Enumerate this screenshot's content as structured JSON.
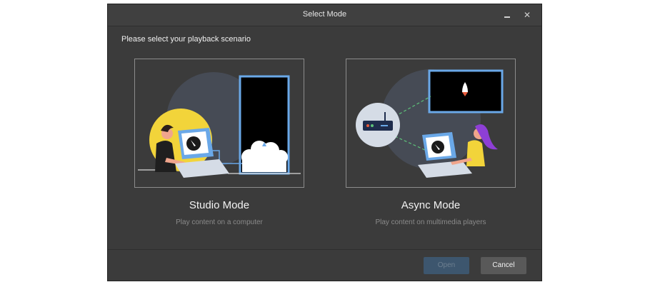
{
  "dialog": {
    "title": "Select Mode",
    "prompt": "Please select your playback scenario",
    "minimize_icon": "minimize-icon",
    "close_icon": "close-icon",
    "close_glyph": "✕"
  },
  "modes": [
    {
      "title": "Studio Mode",
      "description": "Play content on a computer",
      "illustration": "person-at-computer-illustration"
    },
    {
      "title": "Async Mode",
      "description": "Play content on multimedia players",
      "illustration": "media-player-illustration"
    }
  ],
  "footer": {
    "open_label": "Open",
    "open_enabled": false,
    "cancel_label": "Cancel"
  },
  "colors": {
    "dialog_bg": "#3b3b3b",
    "accent_blue": "#6aa8e8",
    "yellow": "#f2d43a",
    "open_disabled_bg": "#3d566e",
    "cancel_bg": "#595959"
  }
}
